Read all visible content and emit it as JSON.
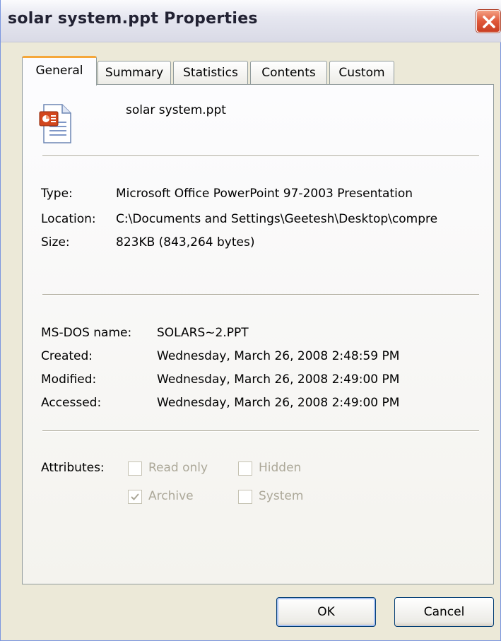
{
  "window": {
    "title": "solar system.ppt Properties"
  },
  "tabs": [
    {
      "label": "General",
      "active": true
    },
    {
      "label": "Summary"
    },
    {
      "label": "Statistics"
    },
    {
      "label": "Contents"
    },
    {
      "label": "Custom"
    }
  ],
  "file": {
    "name": "solar system.ppt",
    "icon": "powerpoint-file-icon"
  },
  "info": {
    "type_label": "Type:",
    "type_value": "Microsoft Office PowerPoint 97-2003 Presentation",
    "location_label": "Location:",
    "location_value": "C:\\Documents and Settings\\Geetesh\\Desktop\\compre",
    "size_label": "Size:",
    "size_value": "823KB (843,264 bytes)"
  },
  "dates": {
    "msdos_label": "MS-DOS name:",
    "msdos_value": "SOLARS~2.PPT",
    "created_label": "Created:",
    "created_value": "Wednesday, March 26, 2008 2:48:59 PM",
    "modified_label": "Modified:",
    "modified_value": "Wednesday, March 26, 2008 2:49:00 PM",
    "accessed_label": "Accessed:",
    "accessed_value": "Wednesday, March 26, 2008 2:49:00 PM"
  },
  "attributes": {
    "label": "Attributes:",
    "read_only": {
      "label": "Read only",
      "checked": false
    },
    "hidden": {
      "label": "Hidden",
      "checked": false
    },
    "archive": {
      "label": "Archive",
      "checked": true
    },
    "system": {
      "label": "System",
      "checked": false
    }
  },
  "buttons": {
    "ok": "OK",
    "cancel": "Cancel"
  },
  "colors": {
    "close_button": "#e0583a",
    "active_tab_accent": "#f5a73a",
    "dialog_bg": "#ece9d8"
  }
}
